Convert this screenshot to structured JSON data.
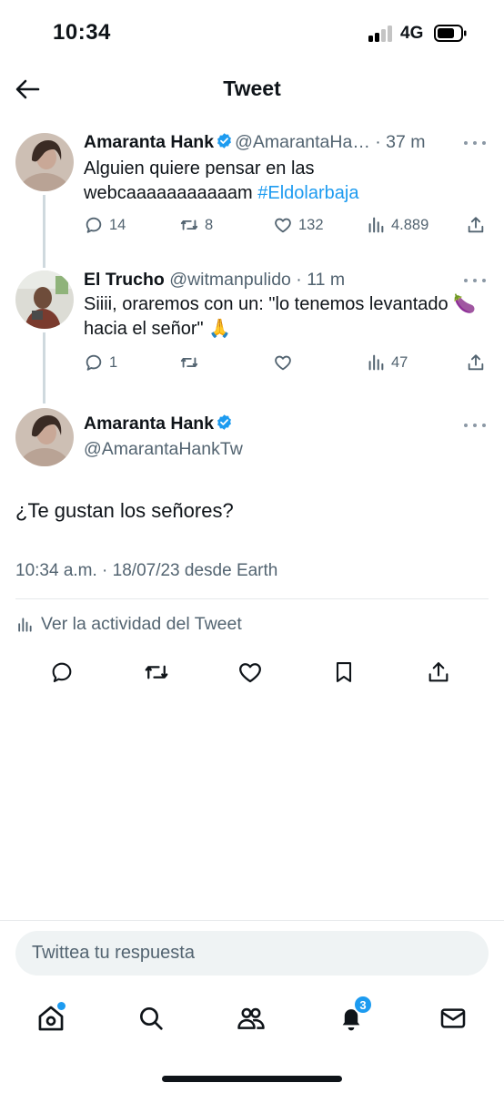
{
  "status_bar": {
    "time": "10:34",
    "network": "4G"
  },
  "header": {
    "title": "Tweet"
  },
  "thread": [
    {
      "name": "Amaranta Hank",
      "handle": "@AmarantaHa…",
      "sep": " · ",
      "time": "37 m",
      "text_plain": "Alguien quiere pensar en las webcaaaaaaaaaaam ",
      "hashtag": "#Eldolarbaja",
      "replies": "14",
      "retweets": "8",
      "likes": "132",
      "views": "4.889"
    },
    {
      "name": "El Trucho",
      "handle": "@witmanpulido",
      "sep": " · ",
      "time": "11 m",
      "text_plain": "Siiii, oraremos con un: \"lo tenemos levantado 🍆 hacia el señor\" 🙏",
      "replies": "1",
      "retweets": "",
      "likes": "",
      "views": "47"
    }
  ],
  "main_tweet": {
    "name": "Amaranta Hank",
    "handle": "@AmarantaHankTw",
    "text": "¿Te gustan los señores?",
    "meta": "10:34 a.m. · 18/07/23 desde Earth",
    "activity_label": "Ver la actividad del Tweet"
  },
  "reply_bar": {
    "placeholder": "Twittea tu respuesta"
  },
  "bottom_nav": {
    "notifications_count": "3"
  },
  "colors": {
    "accent": "#1d9bf0",
    "text": "#0f1419",
    "muted": "#536471",
    "divider": "#e6e9eb"
  }
}
